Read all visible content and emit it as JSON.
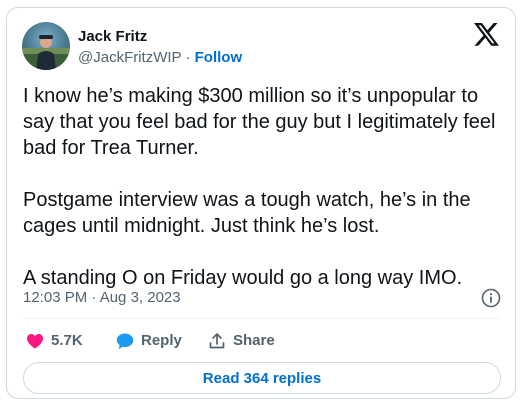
{
  "author": {
    "display_name": "Jack Fritz",
    "handle": "@JackFritzWIP",
    "separator": " · ",
    "follow_label": "Follow"
  },
  "tweet": {
    "paragraphs": [
      "I know he’s making $300 million so it’s unpopular to say that you feel bad for the guy but I legitimately feel bad for Trea Turner.",
      "Postgame interview was a tough watch, he’s in the cages until midnight. Just think he’s lost.",
      "A standing O on Friday would go a long way IMO."
    ],
    "timestamp": "12:03 PM · Aug 3, 2023"
  },
  "actions": {
    "like_count": "5.7K",
    "reply_label": "Reply",
    "share_label": "Share"
  },
  "footer": {
    "read_replies_label": "Read 364 replies"
  },
  "colors": {
    "text": "#0f1419",
    "secondary": "#536471",
    "link": "#006fd6",
    "like": "#f91880",
    "reply": "#1d9bf0",
    "border": "#cfd9de"
  },
  "icons": {
    "brand": "x-logo-icon",
    "info": "info-icon",
    "like": "heart-icon",
    "reply": "speech-bubble-icon",
    "share": "share-upload-icon"
  }
}
